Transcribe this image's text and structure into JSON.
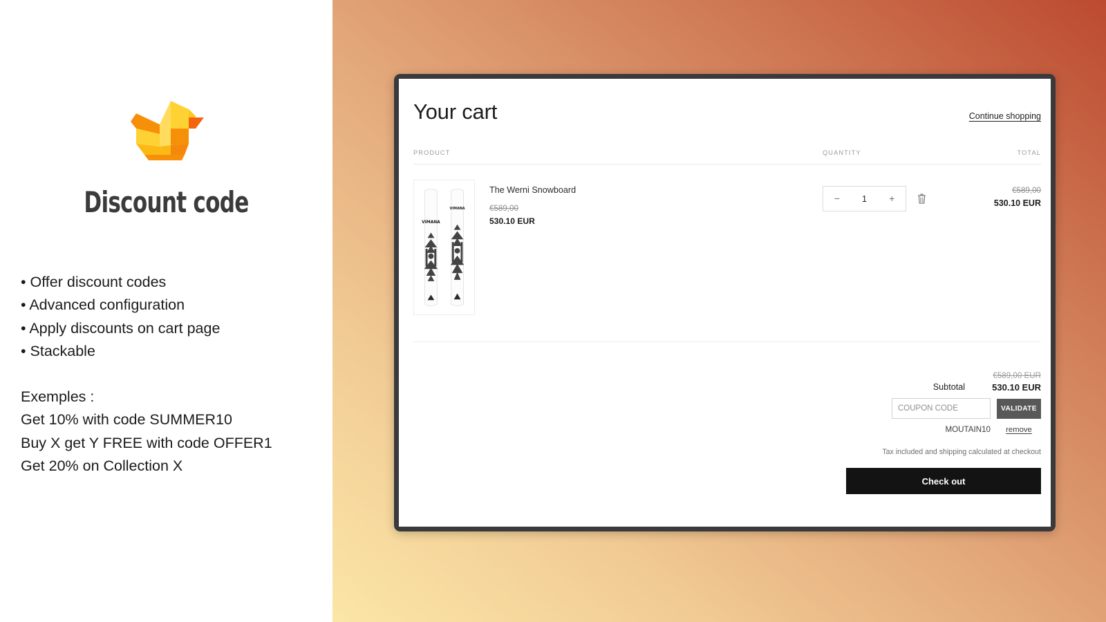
{
  "left": {
    "logo_icon": "origami-duck-logo",
    "title": "Discount code",
    "features": [
      "• Offer discount codes",
      "• Advanced configuration",
      "• Apply discounts on cart page",
      "• Stackable"
    ],
    "examples": [
      "Exemples :",
      "Get 10% with code SUMMER10",
      "Buy X get Y FREE with code OFFER1",
      "Get 20% on Collection X"
    ]
  },
  "cart": {
    "title": "Your cart",
    "continue_shopping": "Continue shopping",
    "columns": {
      "product": "PRODUCT",
      "quantity": "QUANTITY",
      "total": "TOTAL"
    },
    "items": [
      {
        "name": "The Werni Snowboard",
        "original_price": "€589,00",
        "discounted_price": "530.10 EUR",
        "quantity": "1",
        "decrease_label": "−",
        "increase_label": "+",
        "remove_icon": "trash-icon",
        "line_total_original": "€589,00",
        "line_total_discounted": "530.10 EUR",
        "thumbnail_alt": "VIMANA snowboard pair"
      }
    ],
    "summary": {
      "subtotal_label": "Subtotal",
      "subtotal_original": "€589,00 EUR",
      "subtotal_discounted": "530.10 EUR",
      "coupon_placeholder": "COUPON CODE",
      "coupon_value": "",
      "validate_label": "VALIDATE",
      "applied_code": "MOUTAIN10",
      "remove_label": "remove",
      "tax_note": "Tax included and shipping calculated at checkout",
      "checkout_label": "Check out"
    }
  },
  "colors": {
    "gradient_start": "#fbe6a6",
    "gradient_end": "#bc4a30",
    "frame": "#3a3a3c",
    "checkout_bg": "#131313",
    "validate_bg": "#585858",
    "logo_yellow": "#FFD233",
    "logo_orange": "#F79009",
    "logo_deep_orange": "#F4640C"
  }
}
